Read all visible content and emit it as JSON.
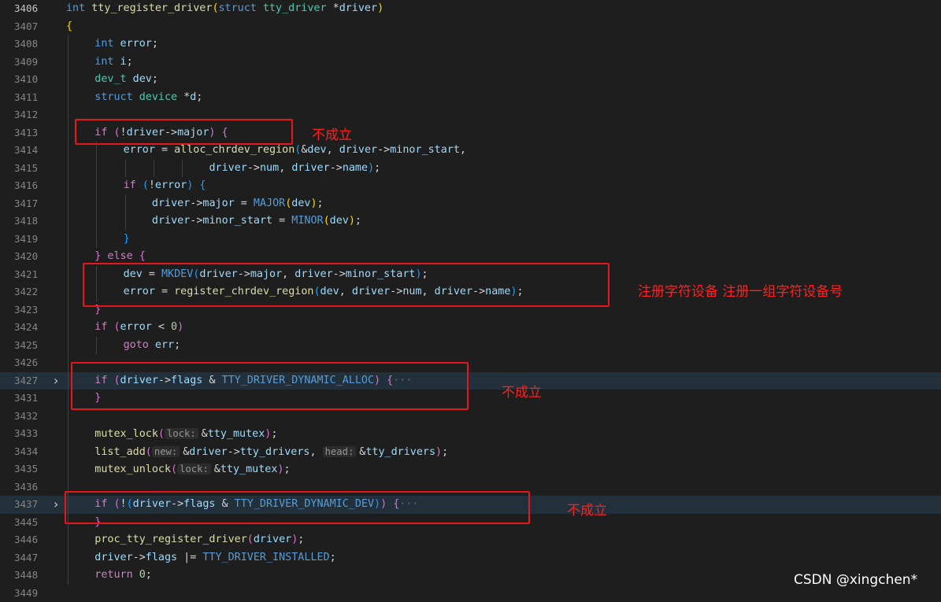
{
  "editor": {
    "first_line": 3406,
    "active_line": 3406,
    "lines": [
      {
        "no": "3406",
        "indent": 0,
        "tokens": [
          [
            "kw",
            "int "
          ],
          [
            "fn",
            "tty_register_driver"
          ],
          [
            "p1",
            "("
          ],
          [
            "kw",
            "struct "
          ],
          [
            "type",
            "tty_driver "
          ],
          [
            "op",
            "*"
          ],
          [
            "id",
            "driver"
          ],
          [
            "p1",
            ")"
          ]
        ]
      },
      {
        "no": "3407",
        "indent": 0,
        "tokens": [
          [
            "p1",
            "{"
          ]
        ]
      },
      {
        "no": "3408",
        "indent": 1,
        "tokens": [
          [
            "kw",
            "int "
          ],
          [
            "id",
            "error"
          ],
          [
            "op",
            ";"
          ]
        ]
      },
      {
        "no": "3409",
        "indent": 1,
        "tokens": [
          [
            "kw",
            "int "
          ],
          [
            "id",
            "i"
          ],
          [
            "op",
            ";"
          ]
        ]
      },
      {
        "no": "3410",
        "indent": 1,
        "tokens": [
          [
            "type",
            "dev_t "
          ],
          [
            "id",
            "dev"
          ],
          [
            "op",
            ";"
          ]
        ]
      },
      {
        "no": "3411",
        "indent": 1,
        "tokens": [
          [
            "kw",
            "struct "
          ],
          [
            "type",
            "device "
          ],
          [
            "op",
            "*"
          ],
          [
            "id",
            "d"
          ],
          [
            "op",
            ";"
          ]
        ]
      },
      {
        "no": "3412",
        "indent": 1,
        "tokens": []
      },
      {
        "no": "3413",
        "indent": 1,
        "tokens": [
          [
            "ctl",
            "if "
          ],
          [
            "p2",
            "("
          ],
          [
            "op",
            "!"
          ],
          [
            "id",
            "driver"
          ],
          [
            "op",
            "->"
          ],
          [
            "id",
            "major"
          ],
          [
            "p2",
            ") "
          ],
          [
            "p2",
            "{"
          ]
        ]
      },
      {
        "no": "3414",
        "indent": 2,
        "tokens": [
          [
            "id",
            "error "
          ],
          [
            "op",
            "= "
          ],
          [
            "fn",
            "alloc_chrdev_region"
          ],
          [
            "p3",
            "("
          ],
          [
            "op",
            "&"
          ],
          [
            "id",
            "dev"
          ],
          [
            "op",
            ", "
          ],
          [
            "id",
            "driver"
          ],
          [
            "op",
            "->"
          ],
          [
            "id",
            "minor_start"
          ],
          [
            "op",
            ","
          ]
        ]
      },
      {
        "no": "3415",
        "indent": 5,
        "tokens": [
          [
            "id",
            "driver"
          ],
          [
            "op",
            "->"
          ],
          [
            "id",
            "num"
          ],
          [
            "op",
            ", "
          ],
          [
            "id",
            "driver"
          ],
          [
            "op",
            "->"
          ],
          [
            "id",
            "name"
          ],
          [
            "p3",
            ")"
          ],
          [
            "op",
            ";"
          ]
        ]
      },
      {
        "no": "3416",
        "indent": 2,
        "tokens": [
          [
            "ctl",
            "if "
          ],
          [
            "p3",
            "("
          ],
          [
            "op",
            "!"
          ],
          [
            "id",
            "error"
          ],
          [
            "p3",
            ") "
          ],
          [
            "p3",
            "{"
          ]
        ]
      },
      {
        "no": "3417",
        "indent": 3,
        "tokens": [
          [
            "id",
            "driver"
          ],
          [
            "op",
            "->"
          ],
          [
            "id",
            "major "
          ],
          [
            "op",
            "= "
          ],
          [
            "mac",
            "MAJOR"
          ],
          [
            "p1",
            "("
          ],
          [
            "id",
            "dev"
          ],
          [
            "p1",
            ")"
          ],
          [
            "op",
            ";"
          ]
        ]
      },
      {
        "no": "3418",
        "indent": 3,
        "tokens": [
          [
            "id",
            "driver"
          ],
          [
            "op",
            "->"
          ],
          [
            "id",
            "minor_start "
          ],
          [
            "op",
            "= "
          ],
          [
            "mac",
            "MINOR"
          ],
          [
            "p1",
            "("
          ],
          [
            "id",
            "dev"
          ],
          [
            "p1",
            ")"
          ],
          [
            "op",
            ";"
          ]
        ]
      },
      {
        "no": "3419",
        "indent": 2,
        "tokens": [
          [
            "p3",
            "}"
          ]
        ]
      },
      {
        "no": "3420",
        "indent": 1,
        "tokens": [
          [
            "p2",
            "} "
          ],
          [
            "ctl",
            "else "
          ],
          [
            "p2",
            "{"
          ]
        ]
      },
      {
        "no": "3421",
        "indent": 2,
        "tokens": [
          [
            "id",
            "dev "
          ],
          [
            "op",
            "= "
          ],
          [
            "mac",
            "MKDEV"
          ],
          [
            "p3",
            "("
          ],
          [
            "id",
            "driver"
          ],
          [
            "op",
            "->"
          ],
          [
            "id",
            "major"
          ],
          [
            "op",
            ", "
          ],
          [
            "id",
            "driver"
          ],
          [
            "op",
            "->"
          ],
          [
            "id",
            "minor_start"
          ],
          [
            "p3",
            ")"
          ],
          [
            "op",
            ";"
          ]
        ]
      },
      {
        "no": "3422",
        "indent": 2,
        "tokens": [
          [
            "id",
            "error "
          ],
          [
            "op",
            "= "
          ],
          [
            "fn",
            "register_chrdev_region"
          ],
          [
            "p3",
            "("
          ],
          [
            "id",
            "dev"
          ],
          [
            "op",
            ", "
          ],
          [
            "id",
            "driver"
          ],
          [
            "op",
            "->"
          ],
          [
            "id",
            "num"
          ],
          [
            "op",
            ", "
          ],
          [
            "id",
            "driver"
          ],
          [
            "op",
            "->"
          ],
          [
            "id",
            "name"
          ],
          [
            "p3",
            ")"
          ],
          [
            "op",
            ";"
          ]
        ]
      },
      {
        "no": "3423",
        "indent": 1,
        "tokens": [
          [
            "p2",
            "}"
          ]
        ]
      },
      {
        "no": "3424",
        "indent": 1,
        "tokens": [
          [
            "ctl",
            "if "
          ],
          [
            "p2",
            "("
          ],
          [
            "id",
            "error "
          ],
          [
            "op",
            "< "
          ],
          [
            "num",
            "0"
          ],
          [
            "p2",
            ")"
          ]
        ]
      },
      {
        "no": "3425",
        "indent": 2,
        "tokens": [
          [
            "ctl",
            "goto "
          ],
          [
            "id",
            "err"
          ],
          [
            "op",
            ";"
          ]
        ]
      },
      {
        "no": "3426",
        "indent": 1,
        "tokens": []
      },
      {
        "no": "3427",
        "indent": 1,
        "fold": true,
        "hl": true,
        "tokens": [
          [
            "ctl",
            "if "
          ],
          [
            "p2",
            "("
          ],
          [
            "id",
            "driver"
          ],
          [
            "op",
            "->"
          ],
          [
            "id",
            "flags "
          ],
          [
            "op",
            "& "
          ],
          [
            "mac",
            "TTY_DRIVER_DYNAMIC_ALLOC"
          ],
          [
            "p2",
            ") "
          ],
          [
            "p2",
            "{"
          ],
          [
            "dim",
            "···"
          ]
        ]
      },
      {
        "no": "3431",
        "indent": 1,
        "tokens": [
          [
            "p2",
            "}"
          ]
        ]
      },
      {
        "no": "3432",
        "indent": 1,
        "tokens": []
      },
      {
        "no": "3433",
        "indent": 1,
        "tokens": [
          [
            "fn",
            "mutex_lock"
          ],
          [
            "p2",
            "("
          ],
          [
            "hint",
            "lock:"
          ],
          [
            "op",
            "&"
          ],
          [
            "id",
            "tty_mutex"
          ],
          [
            "p2",
            ")"
          ],
          [
            "op",
            ";"
          ]
        ]
      },
      {
        "no": "3434",
        "indent": 1,
        "tokens": [
          [
            "fn",
            "list_add"
          ],
          [
            "p2",
            "("
          ],
          [
            "hint",
            "new:"
          ],
          [
            "op",
            "&"
          ],
          [
            "id",
            "driver"
          ],
          [
            "op",
            "->"
          ],
          [
            "id",
            "tty_drivers"
          ],
          [
            "op",
            ", "
          ],
          [
            "hint",
            "head:"
          ],
          [
            "op",
            "&"
          ],
          [
            "id",
            "tty_drivers"
          ],
          [
            "p2",
            ")"
          ],
          [
            "op",
            ";"
          ]
        ]
      },
      {
        "no": "3435",
        "indent": 1,
        "tokens": [
          [
            "fn",
            "mutex_unlock"
          ],
          [
            "p2",
            "("
          ],
          [
            "hint",
            "lock:"
          ],
          [
            "op",
            "&"
          ],
          [
            "id",
            "tty_mutex"
          ],
          [
            "p2",
            ")"
          ],
          [
            "op",
            ";"
          ]
        ]
      },
      {
        "no": "3436",
        "indent": 1,
        "tokens": []
      },
      {
        "no": "3437",
        "indent": 1,
        "fold": true,
        "hl": true,
        "tokens": [
          [
            "ctl",
            "if "
          ],
          [
            "p2",
            "("
          ],
          [
            "op",
            "!"
          ],
          [
            "p3",
            "("
          ],
          [
            "id",
            "driver"
          ],
          [
            "op",
            "->"
          ],
          [
            "id",
            "flags "
          ],
          [
            "op",
            "& "
          ],
          [
            "mac",
            "TTY_DRIVER_DYNAMIC_DEV"
          ],
          [
            "p3",
            ")"
          ],
          [
            "p2",
            ") "
          ],
          [
            "p2",
            "{"
          ],
          [
            "dim",
            "···"
          ]
        ]
      },
      {
        "no": "3445",
        "indent": 1,
        "tokens": [
          [
            "p2",
            "}"
          ]
        ]
      },
      {
        "no": "3446",
        "indent": 1,
        "tokens": [
          [
            "fn",
            "proc_tty_register_driver"
          ],
          [
            "p2",
            "("
          ],
          [
            "id",
            "driver"
          ],
          [
            "p2",
            ")"
          ],
          [
            "op",
            ";"
          ]
        ]
      },
      {
        "no": "3447",
        "indent": 1,
        "tokens": [
          [
            "id",
            "driver"
          ],
          [
            "op",
            "->"
          ],
          [
            "id",
            "flags "
          ],
          [
            "op",
            "|= "
          ],
          [
            "mac",
            "TTY_DRIVER_INSTALLED"
          ],
          [
            "op",
            ";"
          ]
        ]
      },
      {
        "no": "3448",
        "indent": 1,
        "tokens": [
          [
            "ctl",
            "return "
          ],
          [
            "num",
            "0"
          ],
          [
            "op",
            ";"
          ]
        ]
      },
      {
        "no": "3449",
        "indent": 0,
        "tokens": []
      }
    ]
  },
  "annotations": [
    {
      "label": "不成立"
    },
    {
      "label": "注册字符设备 注册一组字符设备号"
    },
    {
      "label": "不成立"
    },
    {
      "label": "不成立"
    }
  ],
  "watermark": "CSDN @xingchen*",
  "colors": {
    "background": "#1e1e1e",
    "annotation_red": "#e5171d",
    "line_highlight": "#22303c"
  }
}
